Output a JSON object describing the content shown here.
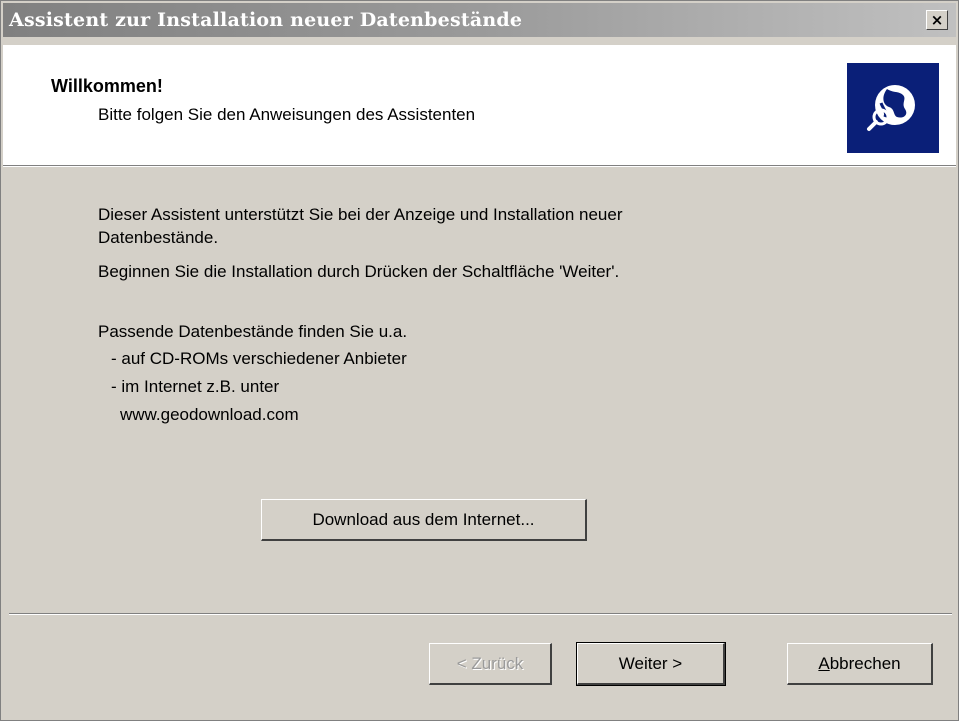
{
  "window": {
    "title": "Assistent zur Installation neuer Datenbestände",
    "close_symbol": "×"
  },
  "header": {
    "title": "Willkommen!",
    "subtitle": "Bitte folgen Sie den Anweisungen des Assistenten",
    "logo_icon": "globe-search-icon",
    "logo_bg_color": "#0a1f78"
  },
  "body": {
    "intro_line1": "Dieser Assistent unterstützt Sie bei der Anzeige und Installation neuer",
    "intro_line2": "Datenbestände.",
    "instruction": "Beginnen Sie die Installation durch Drücken der Schaltfläche 'Weiter'.",
    "sources_heading": "Passende Datenbestände finden Sie u.a.",
    "source_cd": "- auf CD-ROMs verschiedener Anbieter",
    "source_internet": "- im Internet z.B. unter",
    "source_url": "www.geodownload.com"
  },
  "buttons": {
    "download": "Download aus dem Internet...",
    "back": "< Zurück",
    "next": "Weiter >",
    "cancel_accel": "A",
    "cancel_rest": "bbrechen"
  },
  "colors": {
    "dialog_bg": "#d4d0c8",
    "titlebar_inactive": "#808080"
  }
}
